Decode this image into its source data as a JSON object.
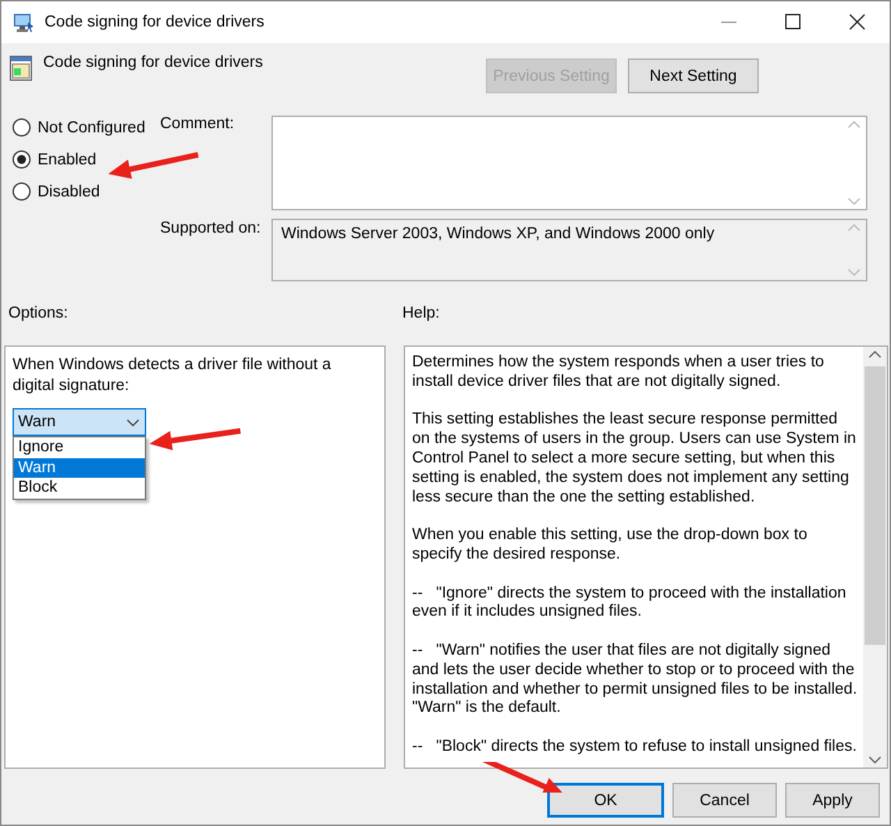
{
  "window": {
    "title": "Code signing for device drivers"
  },
  "setting": {
    "title": "Code signing for device drivers"
  },
  "nav_buttons": [
    {
      "label": "Previous Setting",
      "disabled": true
    },
    {
      "label": "Next Setting",
      "disabled": false
    }
  ],
  "state_options": [
    {
      "label": "Not Configured",
      "selected": false
    },
    {
      "label": "Enabled",
      "selected": true
    },
    {
      "label": "Disabled",
      "selected": false
    }
  ],
  "comment": {
    "label": "Comment:"
  },
  "supported_on": {
    "label": "Supported on:",
    "value": "Windows Server 2003, Windows XP, and Windows 2000 only"
  },
  "options": {
    "label": "Options:",
    "prompt": "When Windows detects a driver file without a digital signature:",
    "dropdown": {
      "value": "Warn",
      "expanded": true,
      "items": [
        {
          "label": "Ignore",
          "selected": false
        },
        {
          "label": "Warn",
          "selected": true
        },
        {
          "label": "Block",
          "selected": false
        }
      ]
    }
  },
  "help": {
    "label": "Help:",
    "paragraphs": [
      "Determines how the system responds when a user tries to install device driver files that are not digitally signed.",
      "This setting establishes the least secure response permitted on the systems of users in the group. Users can use System in Control Panel to select a more secure setting, but when this setting is enabled, the system does not implement any setting less secure than the one the setting established.",
      "When you enable this setting, use the drop-down box to specify the desired response.",
      "--   \"Ignore\" directs the system to proceed with the installation even if it includes unsigned files.",
      "--   \"Warn\" notifies the user that files are not digitally signed and lets the user decide whether to stop or to proceed with the installation and whether to permit unsigned files to be installed. \"Warn\" is the default.",
      "--   \"Block\" directs the system to refuse to install unsigned files."
    ]
  },
  "buttons": [
    {
      "label": "OK",
      "default": true
    },
    {
      "label": "Cancel",
      "default": false
    },
    {
      "label": "Apply",
      "default": false
    }
  ],
  "annotations": [
    {
      "kind": "arrow"
    },
    {
      "kind": "arrow"
    },
    {
      "kind": "arrow"
    }
  ]
}
